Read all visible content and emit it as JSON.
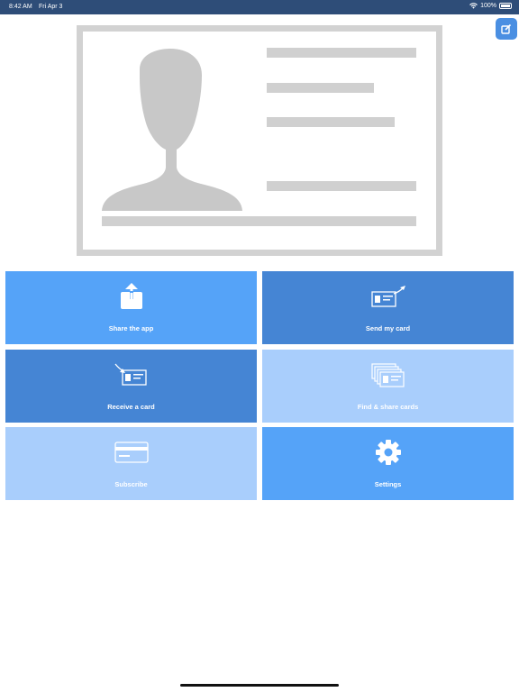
{
  "status_bar": {
    "time": "8:42 AM",
    "date": "Fri Apr 3",
    "battery": "100%"
  },
  "header": {
    "edit_icon": "edit-icon"
  },
  "card_preview": {
    "placeholder": "id-card-placeholder"
  },
  "tiles": [
    {
      "label": "Share the app",
      "icon": "share-icon",
      "color": "#55a3f8"
    },
    {
      "label": "Send my card",
      "icon": "send-card-icon",
      "color": "#4585d4"
    },
    {
      "label": "Receive a card",
      "icon": "receive-card-icon",
      "color": "#4585d4"
    },
    {
      "label": "Find & share cards",
      "icon": "cards-stack-icon",
      "color": "#a9cefc"
    },
    {
      "label": "Subscribe",
      "icon": "credit-card-icon",
      "color": "#a9cefc"
    },
    {
      "label": "Settings",
      "icon": "gear-icon",
      "color": "#55a3f8"
    }
  ]
}
